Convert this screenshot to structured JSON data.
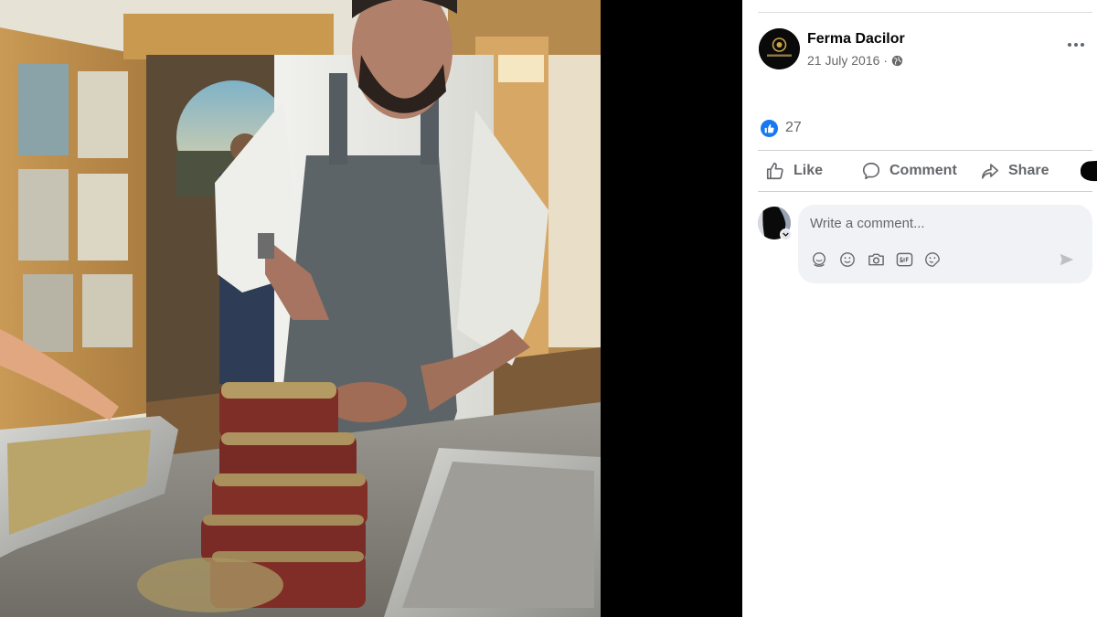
{
  "post": {
    "page_name": "Ferma Dacilor",
    "date": "21 July 2016",
    "separator": "·",
    "privacy_icon": "globe-icon",
    "more_icon": "more-options-icon",
    "avatar_text": "FERMA DACILOR"
  },
  "reactions": {
    "icon": "like-reaction-icon",
    "count": "27"
  },
  "actions": {
    "like_label": "Like",
    "comment_label": "Comment",
    "share_label": "Share"
  },
  "comment_box": {
    "placeholder": "Write a comment...",
    "tools": [
      "avatar-sticker-icon",
      "emoji-icon",
      "camera-icon",
      "gif-icon",
      "sticker-icon"
    ],
    "send_icon": "send-icon"
  },
  "colors": {
    "accent": "#1877f2",
    "secondary_text": "#65676b",
    "comment_bg": "#f0f2f5",
    "divider": "#ced0d4"
  }
}
